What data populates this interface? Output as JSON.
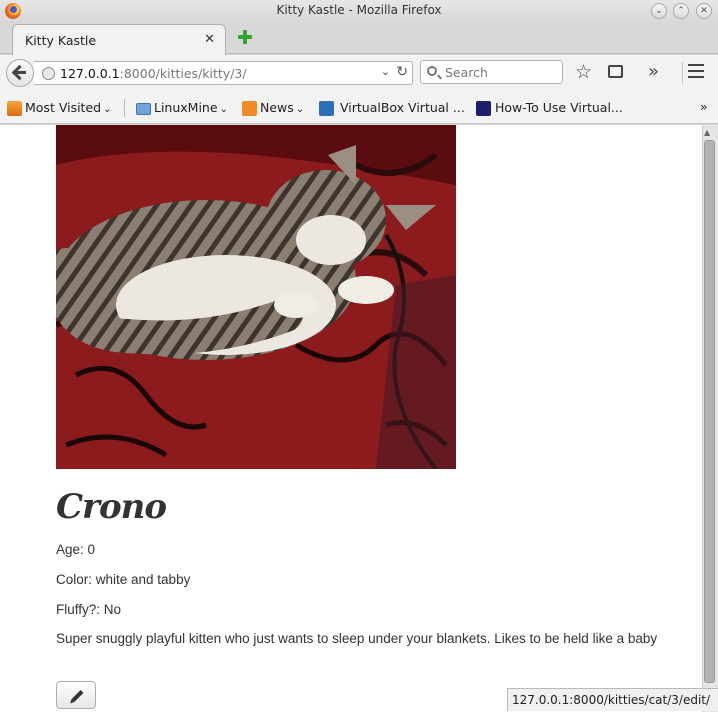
{
  "window": {
    "title": "Kitty Kastle - Mozilla Firefox",
    "minimize_glyph": "⌄",
    "maximize_glyph": "⌃",
    "close_glyph": "✕"
  },
  "tab": {
    "label": "Kitty Kastle",
    "close_glyph": "✕"
  },
  "nav": {
    "url_host": "127.0.0.1",
    "url_path": ":8000/kitties/kitty/3/",
    "search_placeholder": "Search",
    "dropdown_glyph": "⌄",
    "reload_glyph": "↻",
    "bookmark_glyph": "☆",
    "overflow_glyph": "»"
  },
  "bookmarks": [
    {
      "label": "Most Visited",
      "dropdown": "⌄"
    },
    {
      "label": "LinuxMine",
      "dropdown": "⌄"
    },
    {
      "label": "News",
      "dropdown": "⌄"
    },
    {
      "label": "VirtualBox Virtual ..."
    },
    {
      "label": "How-To Use Virtual..."
    }
  ],
  "bookmarks_overflow": "»",
  "kitty": {
    "name": "Crono",
    "age": "Age: 0",
    "color": "Color: white and tabby",
    "fluffy": "Fluffy?: No",
    "description": "Super snuggly playful kitten who just wants to sleep under your blankets. Likes to be held like a baby"
  },
  "status": {
    "link": "127.0.0.1:8000/kitties/cat/3/edit/"
  },
  "colors": {
    "blanket": "#8c1b1e",
    "fur_light": "#e8e4dd",
    "fur_tabby": "#6f6459"
  },
  "icons": [
    "firefox-logo-icon",
    "back-arrow-icon",
    "globe-icon",
    "search-icon",
    "star-icon",
    "reading-list-icon",
    "menu-icon",
    "pencil-icon"
  ]
}
